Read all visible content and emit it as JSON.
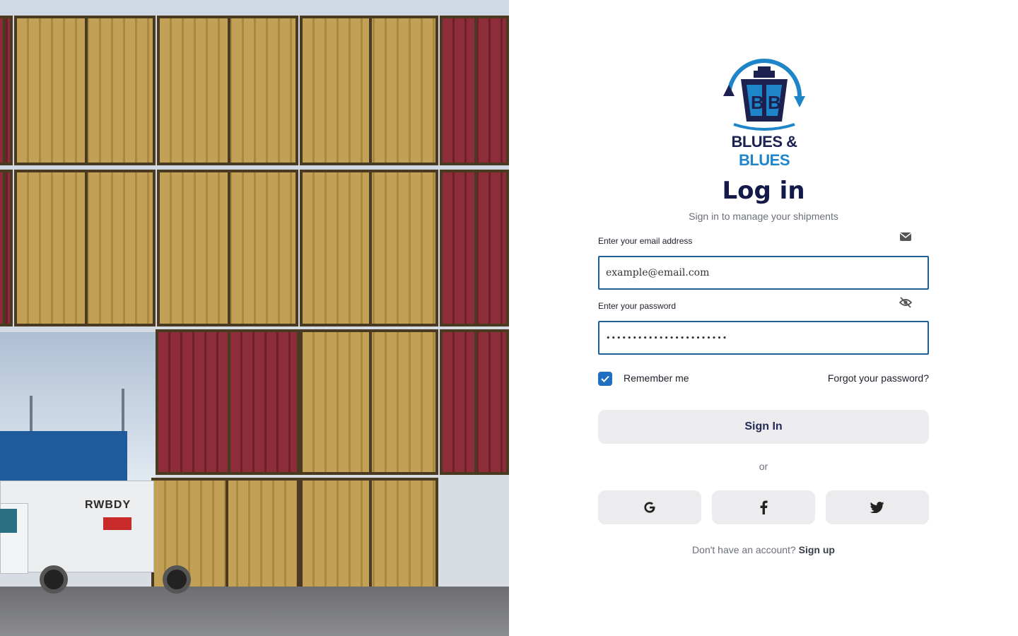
{
  "brand": {
    "name_part1": "BLUES",
    "name_amp": " & ",
    "name_part2": "BLUES",
    "colors": {
      "navy": "#1c2150",
      "blue": "#1e86c8"
    }
  },
  "hero": {
    "truck_text": "RWBDY"
  },
  "login": {
    "title": "Log in",
    "subtitle": "Sign in to manage your shipments",
    "email": {
      "label": "Enter your email address",
      "placeholder": "example@email.com",
      "icon": "envelope-icon"
    },
    "password": {
      "label": "Enter your password",
      "value": "•••••••••••••••••••••••",
      "icon": "eye-slash-icon"
    },
    "remember_label": "Remember me",
    "remember_checked": true,
    "forgot_label": "Forgot your password?",
    "signin_label": "Sign In",
    "or_label": "or",
    "social": [
      {
        "name": "google",
        "icon": "google-icon"
      },
      {
        "name": "facebook",
        "icon": "facebook-icon"
      },
      {
        "name": "twitter",
        "icon": "twitter-icon"
      }
    ],
    "signup_prompt": "Don't have an account?",
    "signup_link": "Sign up"
  },
  "colors": {
    "accent": "#1e6fc0",
    "input_border": "#1f5f95",
    "button_bg": "#ececee",
    "title": "#131a4a"
  }
}
